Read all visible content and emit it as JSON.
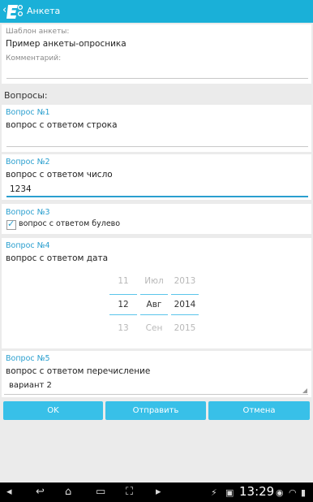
{
  "app": {
    "title": "Анкета"
  },
  "template": {
    "label": "Шаблон анкеты:",
    "value": "Пример анкеты-опросника",
    "comment_label": "Комментарий:",
    "comment_value": ""
  },
  "section_title": "Вопросы:",
  "questions": [
    {
      "number": "Вопрос №1",
      "text": "вопрос с ответом строка",
      "answer": ""
    },
    {
      "number": "Вопрос №2",
      "text": "вопрос с ответом число",
      "answer": "1234"
    },
    {
      "number": "Вопрос №3",
      "text": "вопрос с ответом булево",
      "checked": true
    },
    {
      "number": "Вопрос №4",
      "text": "вопрос с ответом дата",
      "date_picker": {
        "days": [
          "11",
          "12",
          "13"
        ],
        "months": [
          "Июл",
          "Авг",
          "Сен"
        ],
        "years": [
          "2013",
          "2014",
          "2015"
        ],
        "selected": {
          "day": "12",
          "month": "Авг",
          "year": "2014"
        }
      }
    },
    {
      "number": "Вопрос №5",
      "text": "вопрос с ответом перечисление",
      "selected": "вариант 2"
    }
  ],
  "buttons": {
    "ok": "OK",
    "send": "Отправить",
    "cancel": "Отмена"
  },
  "status": {
    "time": "13:29"
  },
  "colors": {
    "accent": "#1ab0d8",
    "button": "#38c0e8",
    "label": "#2a9fcf"
  }
}
